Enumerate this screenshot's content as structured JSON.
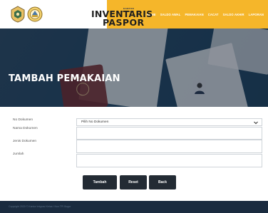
{
  "header": {
    "brand_small": "KANTOR IMIGRASI",
    "brand_line1": "INVENTARIS",
    "brand_line2": "PASPOR",
    "nav": [
      "HOME",
      "SALDO AWAL",
      "PEMAKAIAN",
      "CACAT",
      "SALDO AKHIR",
      "LAPORAN"
    ]
  },
  "hero": {
    "title": "TAMBAH PEMAKAIAN",
    "passport_text": "PASSPORT"
  },
  "form": {
    "no_dokumen_label": "No Dokumen",
    "nama_dokumen_label": "Nama Dokumen",
    "jenis_dokumen_label": "Jenis Dokumen",
    "jumlah_label": "Jumlah",
    "no_dokumen_value": "Pilih No Dokumen",
    "nama_dokumen_value": "",
    "jenis_dokumen_value": "",
    "jumlah_value": ""
  },
  "buttons": {
    "tambah": "Tambah",
    "reset": "Reset",
    "back": "Back"
  },
  "footer": {
    "text": "Copyright 2020 © Kantor Imigrasi Kelas I Non TPI Bogor"
  },
  "colors": {
    "nav_bg": "#f5b62a",
    "hero_bg": "#254a67",
    "button_bg": "#232b34",
    "footer_bg": "#1a2b3f"
  }
}
